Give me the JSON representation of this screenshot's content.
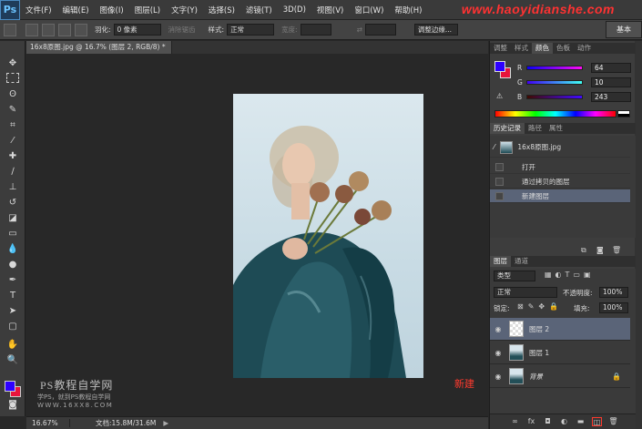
{
  "app": {
    "logo": "Ps",
    "menu": [
      "文件(F)",
      "编辑(E)",
      "图像(I)",
      "图层(L)",
      "文字(Y)",
      "选择(S)",
      "滤镜(T)",
      "3D(D)",
      "视图(V)",
      "窗口(W)",
      "帮助(H)"
    ],
    "watermark_url": "www.haoyidianshe.com",
    "workspace": "基本"
  },
  "options": {
    "feather_label": "羽化:",
    "feather_value": "0 像素",
    "antialias_label": "消除锯齿",
    "style_label": "样式:",
    "style_value": "正常",
    "width_label": "宽度:",
    "refine_edge": "调整边缘..."
  },
  "document": {
    "tab_title": "16x8原图.jpg @ 16.7% (图层 2, RGB/8) *",
    "zoom": "16.67%",
    "doc_size": "文档:15.8M/31.6M"
  },
  "canvas_watermark": {
    "line1": "PS教程自学网",
    "line2": "学PS，就到PS教程自学网",
    "line3": "WWW.16XX8.COM"
  },
  "annotation": {
    "text": "新建",
    "color": "#ff3a2e"
  },
  "colors": {
    "foreground": "#2d00ff",
    "background": "#e8143c"
  },
  "color_panel": {
    "tabs": [
      "调整",
      "样式",
      "颜色",
      "色板",
      "动作"
    ],
    "active_tab": "颜色",
    "r_label": "R",
    "r_value": "64",
    "g_label": "G",
    "g_value": "10",
    "b_label": "B",
    "b_value": "243"
  },
  "history_panel": {
    "tabs": [
      "历史记录",
      "路径",
      "属性"
    ],
    "active_tab": "历史记录",
    "snapshot": "16x8原图.jpg",
    "items": [
      "打开",
      "通过拷贝的图层",
      "新建图层"
    ],
    "selected_index": 2
  },
  "layers_panel": {
    "tabs": [
      "图层",
      "通道"
    ],
    "active_tab": "图层",
    "filter_kind": "类型",
    "blend_mode": "正常",
    "opacity_label": "不透明度:",
    "opacity_value": "100%",
    "lock_label": "锁定:",
    "fill_label": "填充:",
    "fill_value": "100%",
    "layers": [
      {
        "name": "图层 2",
        "selected": true,
        "thumb": "transparent"
      },
      {
        "name": "图层 1",
        "selected": false,
        "thumb": "photo"
      },
      {
        "name": "背景",
        "selected": false,
        "thumb": "photo",
        "locked": true
      }
    ]
  }
}
